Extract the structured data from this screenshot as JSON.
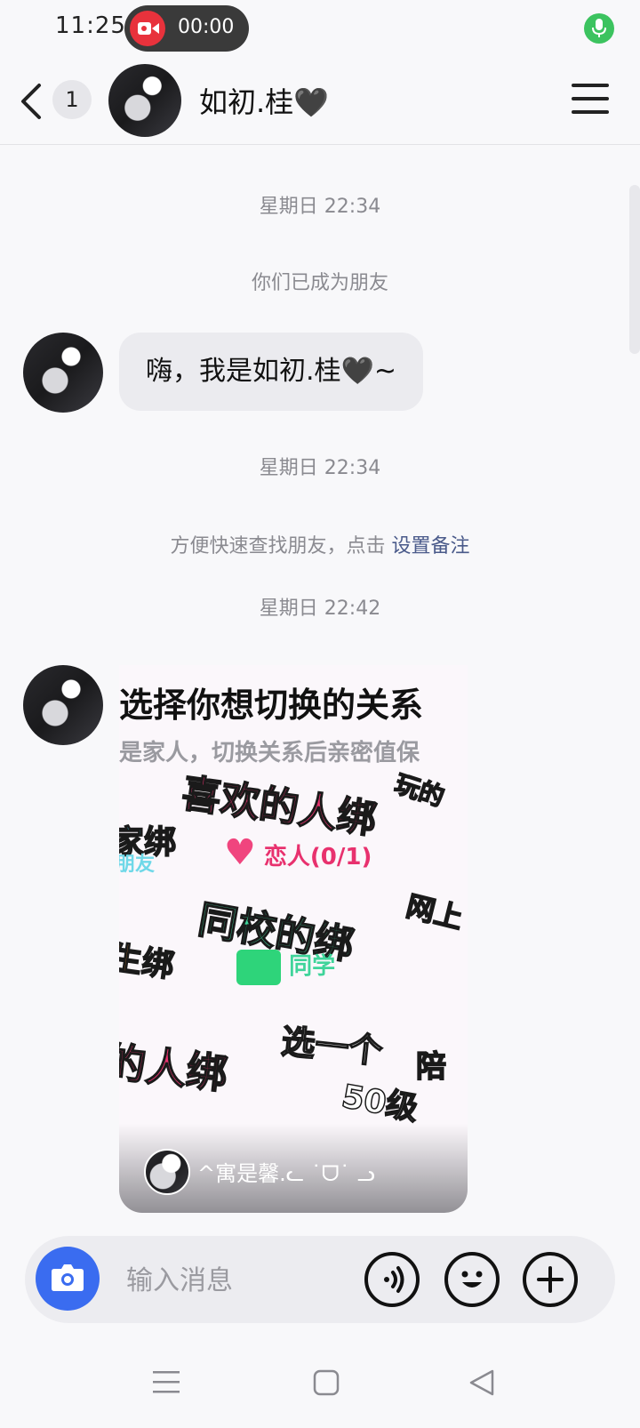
{
  "status_bar": {
    "time": "11:25",
    "recording_time": "00:00",
    "recording_icon": "video-camera-icon",
    "mic_icon": "microphone-icon"
  },
  "header": {
    "back_icon": "back-arrow-icon",
    "unread_count": "1",
    "contact_name": "如初.桂🖤",
    "menu_icon": "menu-icon"
  },
  "chat": {
    "messages": [
      {
        "type": "timestamp",
        "text": "星期日 22:34"
      },
      {
        "type": "system",
        "text": "你们已成为朋友"
      },
      {
        "type": "incoming_text",
        "text": "嗨，我是如初.桂🖤~"
      },
      {
        "type": "timestamp",
        "text": "星期日 22:34"
      },
      {
        "type": "system_prompt",
        "text": "方便快速查找朋友，点击 ",
        "link": "设置备注"
      },
      {
        "type": "timestamp",
        "text": "星期日 22:42"
      },
      {
        "type": "incoming_card",
        "card": {
          "title": "选择你想切换的关系",
          "subtitle": "是家人，切换关系后亲密值保",
          "stickers": [
            "喜欢的人绑",
            "恋人(0/1)",
            "玩的",
            "家绑",
            "朋友",
            "网上",
            "同校的绑",
            "同学",
            "生绑",
            "选一个",
            "陪",
            "50级",
            "的人绑"
          ],
          "author": "^寓是馨.ᓚ ˙ᗜ˙ ᓗ"
        }
      }
    ]
  },
  "input_bar": {
    "placeholder": "输入消息",
    "camera_icon": "camera-icon",
    "voice_icon": "voice-icon",
    "emoji_icon": "emoji-icon",
    "add_icon": "plus-icon"
  },
  "nav_bar": {
    "menu_icon": "recents-icon",
    "home_icon": "home-icon",
    "back_icon": "triangle-back-icon"
  },
  "colors": {
    "accent": "#3a6cf0",
    "recording": "#e8323c",
    "mic": "#3cc35f",
    "bubble": "#ebebef",
    "link": "#4a5a8a"
  }
}
